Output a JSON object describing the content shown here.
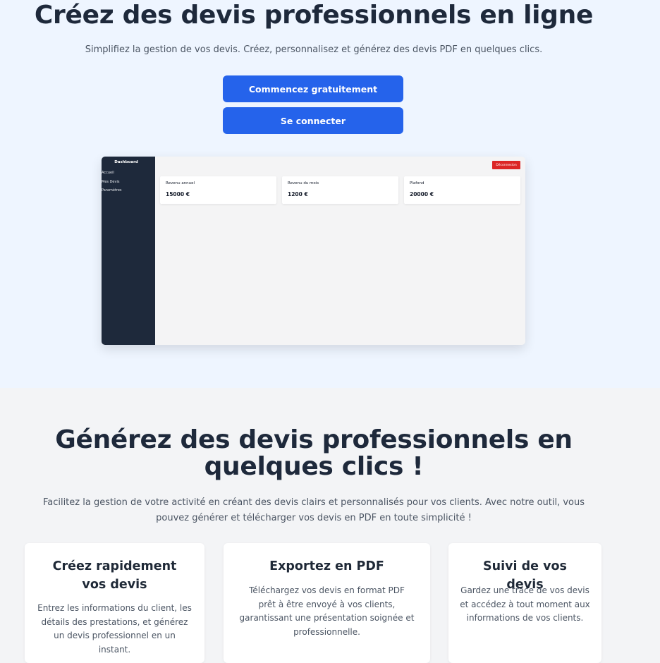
{
  "hero": {
    "title": "Créez des devis professionnels en ligne",
    "subtitle": "Simplifiez la gestion de vos devis. Créez, personnalisez et générez des devis PDF en quelques clics.",
    "cta_primary": "Commencez gratuitement",
    "cta_secondary": "Se connecter"
  },
  "preview": {
    "sidebar_title": "Dashboard",
    "sidebar_items": [
      "Accueil",
      "Mes Devis",
      "Paramètres"
    ],
    "logout_label": "Déconnexion",
    "cards": [
      {
        "label": "Revenu annuel",
        "value": "15000 €"
      },
      {
        "label": "Revenu du mois",
        "value": "1200 €"
      },
      {
        "label": "Plafond",
        "value": "20000 €"
      }
    ]
  },
  "section": {
    "title_line1": "Générez des devis professionnels en",
    "title_line2": "quelques clics !",
    "subtitle": "Facilitez la gestion de votre activité en créant des devis clairs et personnalisés pour vos clients. Avec notre outil, vous pouvez générer et télécharger vos devis en PDF en toute simplicité !"
  },
  "features": [
    {
      "title": "Créez rapidement vos devis",
      "text": "Entrez les informations du client, les détails des prestations, et générez un devis professionnel en un instant."
    },
    {
      "title": "Exportez en PDF",
      "text": "Téléchargez vos devis en format PDF prêt à être envoyé à vos clients, garantissant une présentation soignée et professionnelle."
    },
    {
      "title": "Suivi de vos devis",
      "text": "Gardez une trace de vos devis et accédez à tout moment aux informations de vos clients."
    }
  ],
  "colors": {
    "accent": "#2563eb",
    "danger": "#dc2626",
    "sidebar": "#1e293b"
  }
}
